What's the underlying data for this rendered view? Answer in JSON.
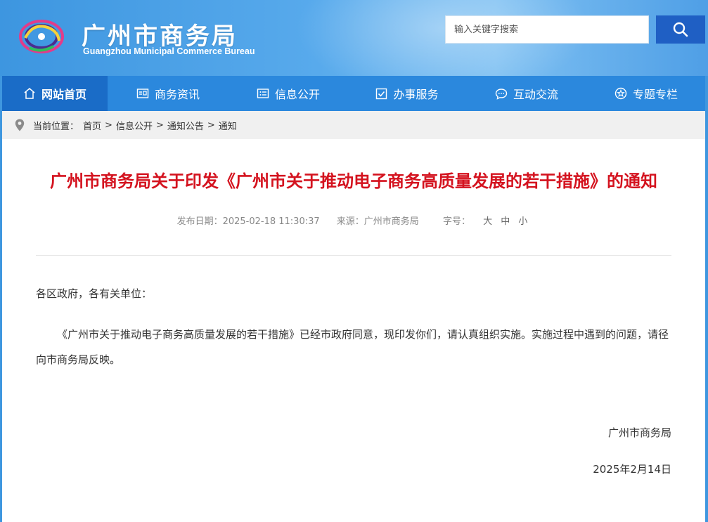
{
  "header": {
    "title_cn": "广州市商务局",
    "title_en": "Guangzhou Municipal Commerce Bureau",
    "search_placeholder": "输入关键字搜索",
    "brand_color": "#2b88dd"
  },
  "nav": {
    "items": [
      {
        "label": "网站首页",
        "icon": "home-icon",
        "active": true
      },
      {
        "label": "商务资讯",
        "icon": "news-icon"
      },
      {
        "label": "信息公开",
        "icon": "info-card-icon"
      },
      {
        "label": "办事服务",
        "icon": "checkbox-icon"
      },
      {
        "label": "互动交流",
        "icon": "chat-icon"
      },
      {
        "label": "专题专栏",
        "icon": "star-icon"
      }
    ]
  },
  "breadcrumb": {
    "prefix": "当前位置：",
    "items": [
      "首页",
      "信息公开",
      "通知公告",
      "通知"
    ],
    "separator": ">"
  },
  "article": {
    "title": "广州市商务局关于印发《广州市关于推动电子商务高质量发展的若干措施》的通知",
    "publish_date": "发布日期：2025-02-18 11:30:37",
    "source": "来源：广州市商务局",
    "font_size_label": "字号：",
    "font_sizes": [
      "大",
      "中",
      "小"
    ],
    "salutation": "各区政府，各有关单位：",
    "paragraph": "《广州市关于推动电子商务高质量发展的若干措施》已经市政府同意，现印发你们，请认真组织实施。实施过程中遇到的问题，请径向市商务局反映。",
    "signature": "广州市商务局",
    "sign_date": "2025年2月14日",
    "title_color": "#d4131f"
  }
}
